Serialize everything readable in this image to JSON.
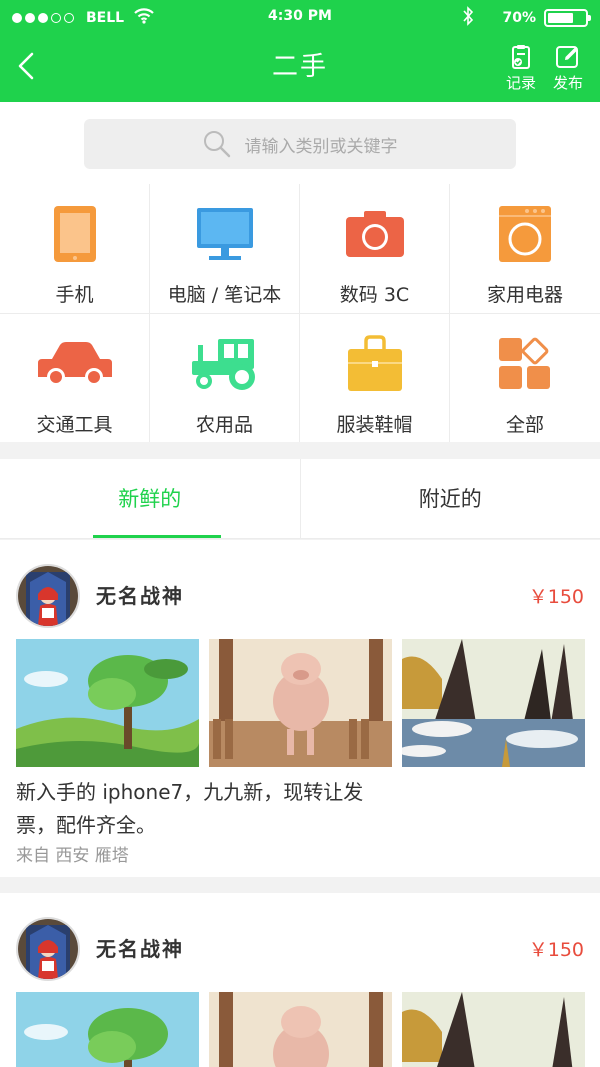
{
  "status_bar": {
    "carrier": "BELL",
    "time": "4:30 PM",
    "battery_text": "70%",
    "battery_level": 0.7,
    "signal_dots_filled": 3,
    "signal_dots_total": 5
  },
  "nav": {
    "title": "二手",
    "record_label": "记录",
    "publish_label": "发布",
    "back_icon": "chevron-left-icon"
  },
  "search": {
    "placeholder": "请输入类别或关键字"
  },
  "categories": [
    {
      "label": "手机",
      "icon": "phone-icon",
      "color": "#f59a3c"
    },
    {
      "label": "电脑 / 笔记本",
      "icon": "computer-icon",
      "color": "#3a9ae0"
    },
    {
      "label": "数码 3C",
      "icon": "camera-icon",
      "color": "#ec6446"
    },
    {
      "label": "家用电器",
      "icon": "washing-machine-icon",
      "color": "#f59a3c"
    },
    {
      "label": "交通工具",
      "icon": "car-icon",
      "color": "#ec6446"
    },
    {
      "label": "农用品",
      "icon": "tractor-icon",
      "color": "#3dde8f"
    },
    {
      "label": "服装鞋帽",
      "icon": "briefcase-icon",
      "color": "#f3bd35"
    },
    {
      "label": "全部",
      "icon": "all-categories-icon",
      "color": "#f08f4a"
    }
  ],
  "tabs": [
    {
      "label": "新鲜的",
      "active": true
    },
    {
      "label": "附近的",
      "active": false
    }
  ],
  "posts": [
    {
      "user": "无名战神",
      "price": "￥150",
      "description": "新入手的 iphone7，九九新，现转让发票，配件齐全。",
      "location": "来自 西安 雁塔"
    },
    {
      "user": "无名战神",
      "price": "￥150"
    }
  ],
  "colors": {
    "accent": "#1fd24c",
    "price": "#e84c3d"
  }
}
